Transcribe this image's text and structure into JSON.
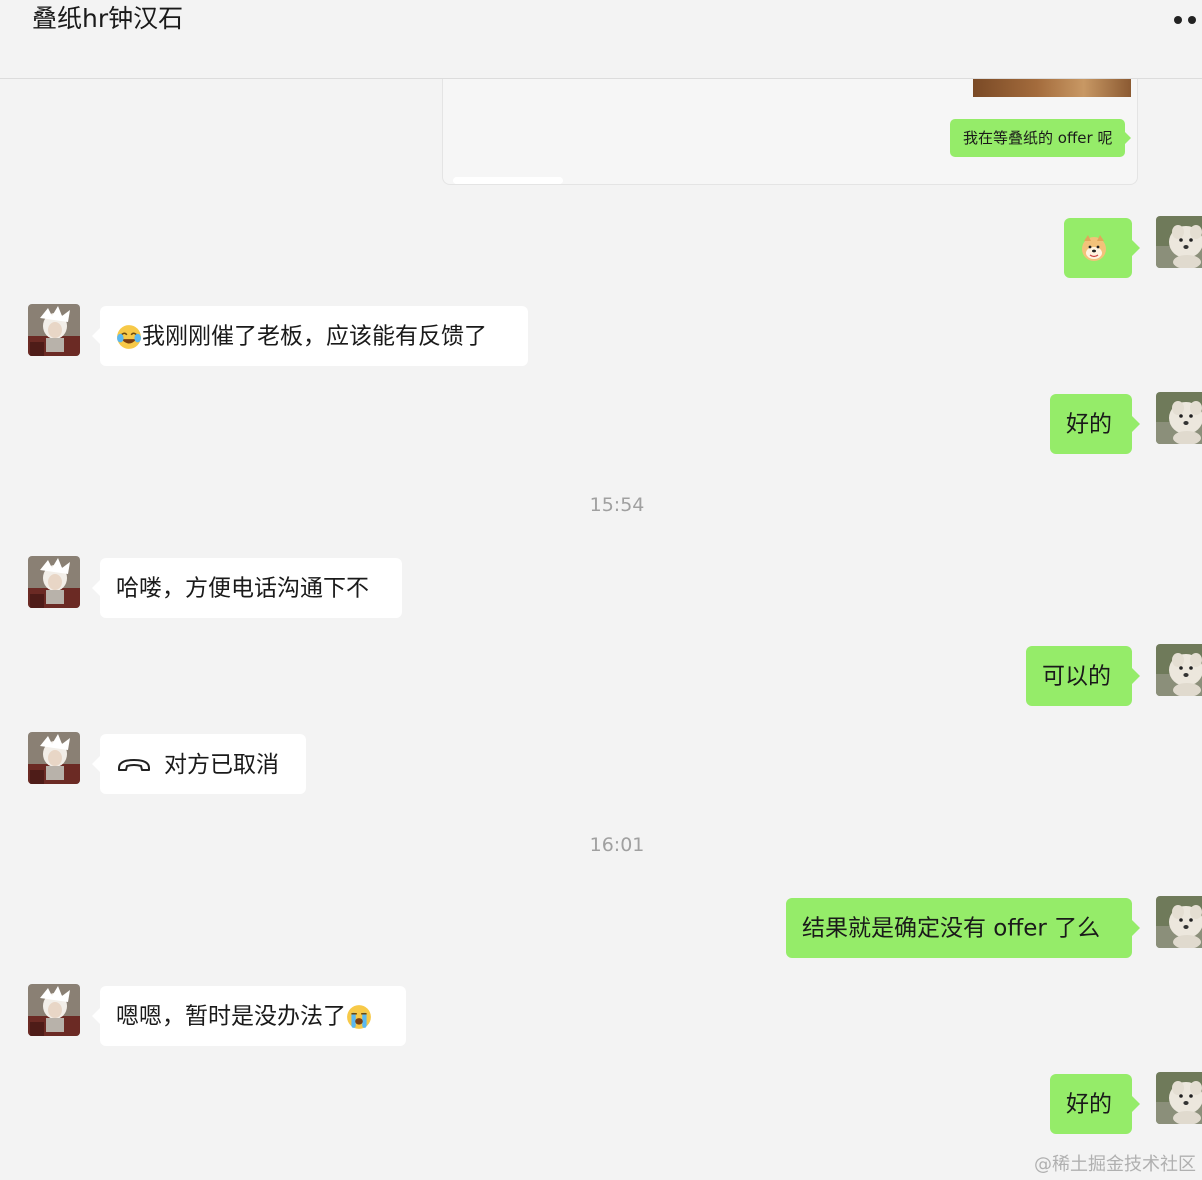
{
  "header": {
    "title": "叠纸hr钟汉石",
    "more_icon": "more-dots-icon"
  },
  "quoted_card": {
    "bubble_text": "我在等叠纸的 offer 呢"
  },
  "messages": [
    {
      "side": "out",
      "emoji": "doge-emoji"
    },
    {
      "side": "in",
      "emoji": "laugh-cry-emoji",
      "text": "我刚刚催了老板，应该能有反馈了"
    },
    {
      "side": "out",
      "text": "好的"
    },
    {
      "side": "out",
      "text": "可以的"
    },
    {
      "side": "in",
      "text": "哈喽，方便电话沟通下不"
    },
    {
      "side": "in",
      "icon": "phone-hangup-icon",
      "text": "对方已取消"
    },
    {
      "side": "out",
      "text": "结果就是确定没有 offer 了么"
    },
    {
      "side": "in",
      "text": "嗯嗯，暂时是没办法了",
      "emoji": "crying-emoji"
    },
    {
      "side": "out",
      "text": "好的"
    }
  ],
  "timestamps": [
    "15:54",
    "16:01"
  ],
  "watermark": "@稀土掘金技术社区",
  "colors": {
    "background": "#f3f3f3",
    "outgoing_bubble": "#95ec69",
    "incoming_bubble": "#ffffff",
    "timestamp": "#a0a0a0"
  }
}
